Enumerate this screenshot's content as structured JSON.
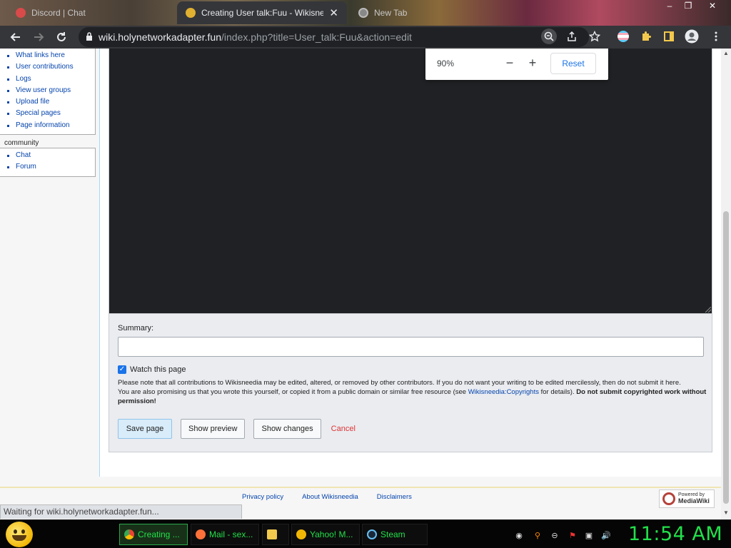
{
  "browser": {
    "tabs": [
      {
        "title": "Discord | Chat",
        "active": false
      },
      {
        "title": "Creating User talk:Fuu - Wikisneedia",
        "active": true
      },
      {
        "title": "New Tab",
        "active": false
      }
    ],
    "close_glyph": "✕",
    "url_host": "wiki.holynetworkadapter.fun",
    "url_path": "/index.php?title=User_talk:Fuu&action=edit",
    "window_controls": {
      "minimize": "–",
      "maximize": "❐",
      "close": "✕"
    }
  },
  "zoom_popup": {
    "level": "90%",
    "minus": "−",
    "plus": "+",
    "reset_label": "Reset"
  },
  "sidebar": {
    "tools": [
      "What links here",
      "User contributions",
      "Logs",
      "View user groups",
      "Upload file",
      "Special pages",
      "Page information"
    ],
    "community_title": "community",
    "community": [
      "Chat",
      "Forum"
    ]
  },
  "editor": {
    "summary_label": "Summary:",
    "summary_value": "",
    "watch_label": "Watch this page",
    "watch_checked": true,
    "notice_1": "Please note that all contributions to Wikisneedia may be edited, altered, or removed by other contributors. If you do not want your writing to be edited mercilessly, then do not submit it here.",
    "notice_2_prefix": "You are also promising us that you wrote this yourself, or copied it from a public domain or similar free resource (see ",
    "notice_2_link": "Wikisneedia:Copyrights",
    "notice_2_suffix": " for details). ",
    "notice_2_bold": "Do not submit copyrighted work without permission!",
    "save_label": "Save page",
    "preview_label": "Show preview",
    "changes_label": "Show changes",
    "cancel_label": "Cancel"
  },
  "footer": {
    "links": [
      "Privacy policy",
      "About Wikisneedia",
      "Disclaimers"
    ],
    "powered_line1": "Powered by",
    "powered_line2": "MediaWiki"
  },
  "status_text": "Waiting for wiki.holynetworkadapter.fun...",
  "taskbar": {
    "items": [
      {
        "label": "Creating ...",
        "active": true,
        "icon_color": "#ea4335"
      },
      {
        "label": "Mail - sex...",
        "active": false,
        "icon_color": "#ff7139"
      },
      {
        "label": "",
        "active": false,
        "icon_color": "#f2c94c"
      },
      {
        "label": "Yahoo! M...",
        "active": false,
        "icon_color": "#f2b705"
      },
      {
        "label": "Steam",
        "active": false,
        "icon_color": "#66c0f4"
      }
    ],
    "clock": "11:54 AM"
  },
  "colors": {
    "accent_green": "#22e04a",
    "link_blue": "#0645ad",
    "cancel_red": "#d33333",
    "chrome_dark": "#35363a"
  }
}
